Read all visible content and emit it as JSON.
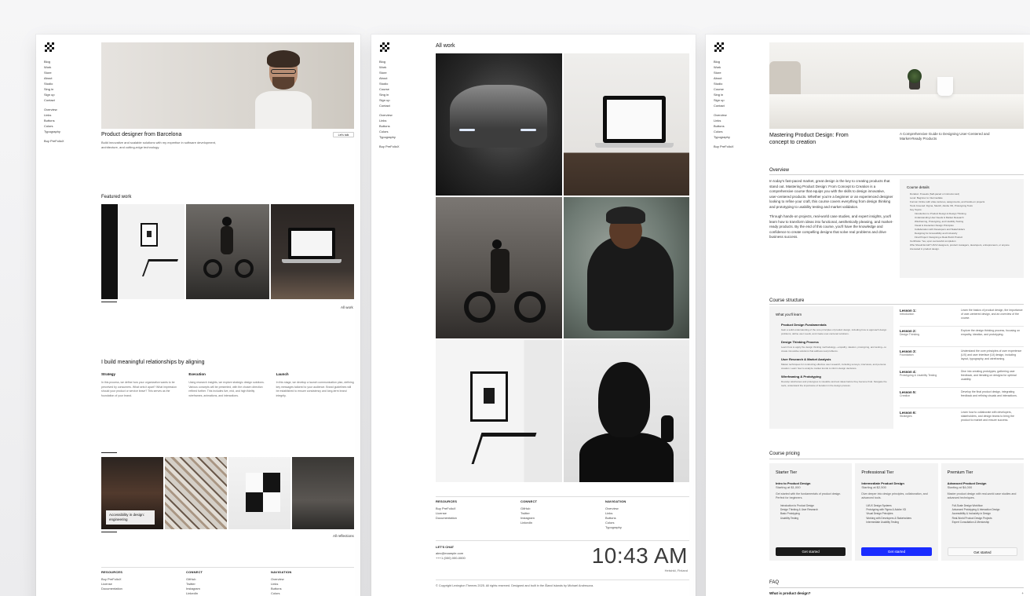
{
  "nav": {
    "items": [
      "Blog",
      "Work",
      "Store",
      "About",
      "Studio",
      "Sing in",
      "Sign up",
      "Contact"
    ],
    "items2": [
      "Overview",
      "Links",
      "Buttons",
      "Colors",
      "Typography"
    ],
    "buy": "Buy PreFolioX"
  },
  "nav_p2": {
    "items": [
      "Blog",
      "Work",
      "Store",
      "About",
      "Studio",
      "Course",
      "Sing in",
      "Sign up",
      "Contact"
    ],
    "items2": [
      "Overview",
      "Links",
      "Buttons",
      "Colors",
      "Typography"
    ],
    "buy": "Buy PreFolioX"
  },
  "home": {
    "headline": "Product designer from Barcelona",
    "description": "Build innovative and scalable solutions with my expertise in software development, architecture, and cutting-edge technology.",
    "talk_button": "Let's talk",
    "featured_title": "Featured work",
    "all_work_link": "All work",
    "relationships_title": "I build meaningful relationships by aligning",
    "columns": [
      {
        "title": "Strategy",
        "body": "In this process, we define how your organization wants to be perceived by consumers. What sets it apart? What impression should your product or service leave? This serves as the foundation of your brand."
      },
      {
        "title": "Execution",
        "body": "Using research insights, we explore strategic design solutions. Various concepts will be presented, with the chosen direction refined further. This includes live, mid, and high fidelity wireframes, animations, and interactions."
      },
      {
        "title": "Launch",
        "body": "In this stage, we develop a launch communication plan, defining key messages tailored to your audience. Brand guidelines will be established to ensure consistency and long-term brand integrity."
      }
    ],
    "reflection_caption": "Accessibility in design: engineering",
    "all_reflections_link": "All reflections"
  },
  "footer": {
    "resources_title": "RESOURCES",
    "resources": [
      "Buy PreFolioX",
      "License",
      "Documentation"
    ],
    "connect_title": "CONNECT",
    "connect": [
      "GitHub",
      "Twitter",
      "Instagram",
      "LinkedIn"
    ],
    "navigation_title": "NAVIGATION",
    "navigation": [
      "Overview",
      "Links",
      "Buttons",
      "Colors",
      "Typography"
    ]
  },
  "work": {
    "title": "All work",
    "chat_title": "LET'S CHAT",
    "email": "alex@example.com",
    "phone": "+++1 (000) 000-0000",
    "clock": "10:43 AM",
    "location": "Helsinki, Finland",
    "copyright": "© Copyright Lexington Themes 2025. All rights reserved. Designed and built in the Åland Islands by Michael Andreuzza."
  },
  "course": {
    "title": "Mastering Product Design: From concept to creation",
    "subtitle": "A Comprehensive Guide to Designing User-Centered and Market-Ready Products",
    "overview_title": "Overview",
    "overview_p1": "In today's fast-paced market, great design is the key to creating products that stand out. Mastering Product Design: From Concept to Creation is a comprehensive course that equips you with the skills to design innovative, user-centered products. Whether you're a beginner or an experienced designer looking to refine your craft, this course covers everything from design thinking and prototyping to usability testing and market validation.",
    "overview_p2": "Through hands-on projects, real-world case studies, and expert insights, you'll learn how to transform ideas into functional, aesthetically pleasing, and market-ready products. By the end of this course, you'll have the knowledge and confidence to create compelling designs that solve real problems and drive business success.",
    "details_title": "Course details",
    "details": [
      {
        "text": "Duration: 8 weeks (Self-paced or instructor-led)",
        "sub": false
      },
      {
        "text": "Level: Beginner to Intermediate",
        "sub": false
      },
      {
        "text": "Format: Online with video lectures, assignments, and hands-on projects",
        "sub": false
      },
      {
        "text": "Tools Covered: Figma, Sketch, Adobe XD, Prototyping Tools",
        "sub": false
      },
      {
        "text": "Key Topics:",
        "sub": false
      },
      {
        "text": "Introduction to Product Design & Design Thinking",
        "sub": true
      },
      {
        "text": "Understanding User Needs & Market Research",
        "sub": true
      },
      {
        "text": "Wireframing, Prototyping, and Usability Testing",
        "sub": true
      },
      {
        "text": "Visual & Interaction Design Principles",
        "sub": true
      },
      {
        "text": "Collaboration with Developers and Stakeholders",
        "sub": true
      },
      {
        "text": "Designing for Accessibility and Inclusivity",
        "sub": true
      },
      {
        "text": "Final Project: Designing a Real-World Product",
        "sub": true
      },
      {
        "text": "Certificate: Yes, upon successful completion",
        "sub": false
      },
      {
        "text": "Who Should Enroll? UX/UI designers, product managers, developers, entrepreneurs, or anyone interested in product design.",
        "sub": false
      }
    ],
    "structure_title": "Course structure",
    "learn_title": "What you'll learn",
    "learn": [
      {
        "title": "Product Design Fundamentals",
        "body": "Gain a solid understanding of the core principles of product design, including how to approach design problems, define user needs, and create user-centered solutions."
      },
      {
        "title": "Design Thinking Process",
        "body": "Learn how to apply the design thinking methodology—empathy, ideation, prototyping, and testing—to create innovative solutions that address real problems."
      },
      {
        "title": "User Research & Market Analysis",
        "body": "Master techniques for conducting effective user research, including surveys, interviews, and persona creation. Learn how to analyze market trends to inform design decisions."
      },
      {
        "title": "Wireframing & Prototyping",
        "body": "Develop wireframes and prototypes to visualize and test ideas before they become final. Navigate the tools, understand the importance of iteration in the design process."
      }
    ],
    "lessons": [
      {
        "num": "Lesson 1:",
        "name": "Introduction",
        "desc": "Learn the basics of product design, the importance of user-centered design, and an overview of the course."
      },
      {
        "num": "Lesson 2:",
        "name": "Design Thinking",
        "desc": "Explore the design thinking process, focusing on empathy, ideation, and prototyping."
      },
      {
        "num": "Lesson 3:",
        "name": "Foundation",
        "desc": "Understand the core principles of user experience (UX) and user interface (UI) design, including layout, typography, and wireframing."
      },
      {
        "num": "Lesson 4:",
        "name": "Prototyping & Usability Testing",
        "desc": "Dive into creating prototypes, gathering user feedback, and iterating on designs for optimal usability."
      },
      {
        "num": "Lesson 5:",
        "name": "Creation",
        "desc": "Develop the final product design, integrating feedback and refining visuals and interactions."
      },
      {
        "num": "Lesson 6:",
        "name": "Strategies",
        "desc": "Learn how to collaborate with developers, stakeholders, and design teams to bring the product to market and ensure success."
      }
    ],
    "pricing_title": "Course pricing",
    "tiers": [
      {
        "name": "Starter Tier",
        "course": "Intro to Product Design",
        "price": "Starting at $1,000",
        "desc": "Get started with the fundamentals of product design. Perfect for beginners.",
        "features": [
          "Introduction to Product Design",
          "Design Thinking & User Research",
          "Basic Prototyping",
          "Usability Testing"
        ],
        "cta": "Get started"
      },
      {
        "name": "Professional Tier",
        "course": "Intermediate Product Design",
        "price": "Starting at $2,500",
        "desc": "Dive deeper into design principles, collaboration, and advanced tools.",
        "features": [
          "UI/UX Design Systems",
          "Prototyping with Figma & Adobe XD",
          "Visual Design Principles",
          "Working with Developers & Stakeholders",
          "Intermediate Usability Testing"
        ],
        "cta": "Get started"
      },
      {
        "name": "Premium Tier",
        "course": "Advanced Product Design",
        "price": "Starting at $4,000",
        "desc": "Master product design with real-world case studies and advanced techniques.",
        "features": [
          "Full-Scale Design Workflow",
          "Advanced Prototyping & Interaction Design",
          "Accessibility & Inclusivity in Design",
          "Real-World Product Design Projects",
          "Expert Consultation & Mentorship"
        ],
        "cta": "Get started"
      }
    ],
    "faq_title": "FAQ",
    "faq_q1": "What is product design?",
    "faq_toggle": "+"
  }
}
